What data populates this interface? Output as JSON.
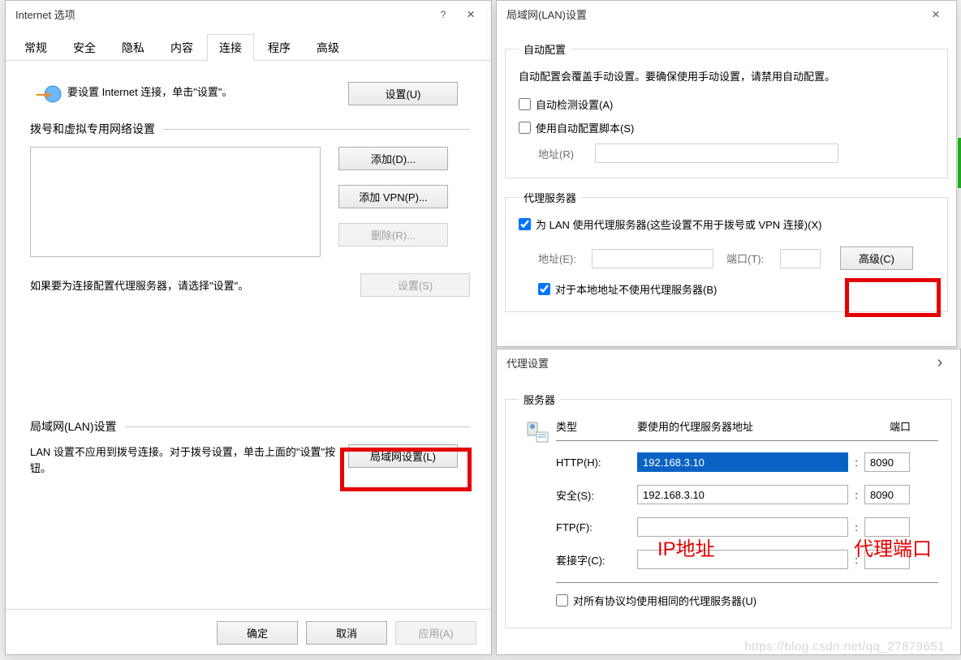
{
  "dlg1": {
    "title": "Internet 选项",
    "help_icon": "?",
    "close_icon": "×",
    "tabs": [
      "常规",
      "安全",
      "隐私",
      "内容",
      "连接",
      "程序",
      "高级"
    ],
    "active_tab_index": 4,
    "intro_text": "要设置 Internet 连接，单击\"设置\"。",
    "btn_setup": "设置(U)",
    "group_dialup": "拨号和虚拟专用网络设置",
    "btn_add": "添加(D)...",
    "btn_add_vpn": "添加 VPN(P)...",
    "btn_remove": "删除(R)...",
    "text_proxy": "如果要为连接配置代理服务器，请选择\"设置\"。",
    "btn_settings": "设置(S)",
    "group_lan": "局域网(LAN)设置",
    "lan_desc": "LAN 设置不应用到拨号连接。对于拨号设置，单击上面的\"设置\"按钮。",
    "btn_lan_settings": "局域网设置(L)",
    "btn_ok": "确定",
    "btn_cancel": "取消",
    "btn_apply": "应用(A)"
  },
  "dlg2": {
    "title": "局域网(LAN)设置",
    "close_icon": "×",
    "fs_auto": "自动配置",
    "auto_note": "自动配置会覆盖手动设置。要确保使用手动设置，请禁用自动配置。",
    "cb_auto_detect": "自动检测设置(A)",
    "cb_use_script": "使用自动配置脚本(S)",
    "label_addr_r": "地址(R)",
    "fs_proxy": "代理服务器",
    "cb_use_proxy": "为 LAN 使用代理服务器(这些设置不用于拨号或 VPN 连接)(X)",
    "label_addr_e": "地址(E):",
    "label_port_t": "端口(T):",
    "btn_adv": "高级(C)",
    "cb_bypass": "对于本地地址不使用代理服务器(B)"
  },
  "dlg3": {
    "title": "代理设置",
    "arrow_icon": "›",
    "fs_server": "服务器",
    "hdr_type": "类型",
    "hdr_addr": "要使用的代理服务器地址",
    "hdr_port": "端口",
    "rows": [
      {
        "label": "HTTP(H):",
        "addr": "192.168.3.10",
        "port": "8090",
        "sel": true
      },
      {
        "label": "安全(S):",
        "addr": "192.168.3.10",
        "port": "8090",
        "sel": false
      },
      {
        "label": "FTP(F):",
        "addr": "",
        "port": "",
        "sel": false
      },
      {
        "label": "套接字(C):",
        "addr": "",
        "port": "",
        "sel": false
      }
    ],
    "cb_same": "对所有协议均使用相同的代理服务器(U)",
    "ann_ip": "IP地址",
    "ann_port": "代理端口"
  },
  "watermark": "https://blog.csdn.net/qq_27879651"
}
